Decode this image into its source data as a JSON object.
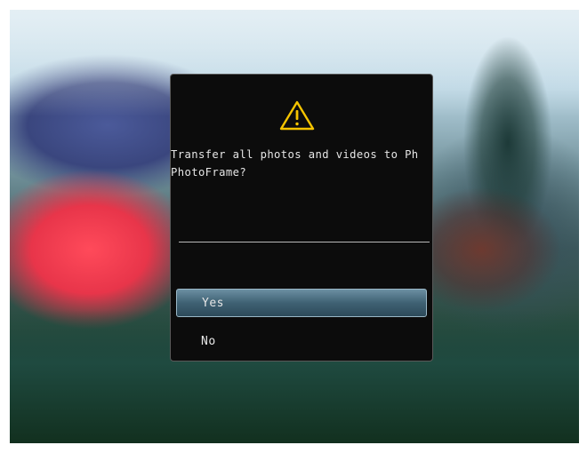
{
  "dialog": {
    "message_line1": "Transfer all photos and videos to Ph",
    "message_line2": "PhotoFrame?",
    "warning_icon": "warning-triangle-icon",
    "options": [
      {
        "label": "Yes",
        "selected": true
      },
      {
        "label": "No",
        "selected": false
      }
    ],
    "accent_color": "#f5c400",
    "selected_color": "#4a6f83"
  }
}
